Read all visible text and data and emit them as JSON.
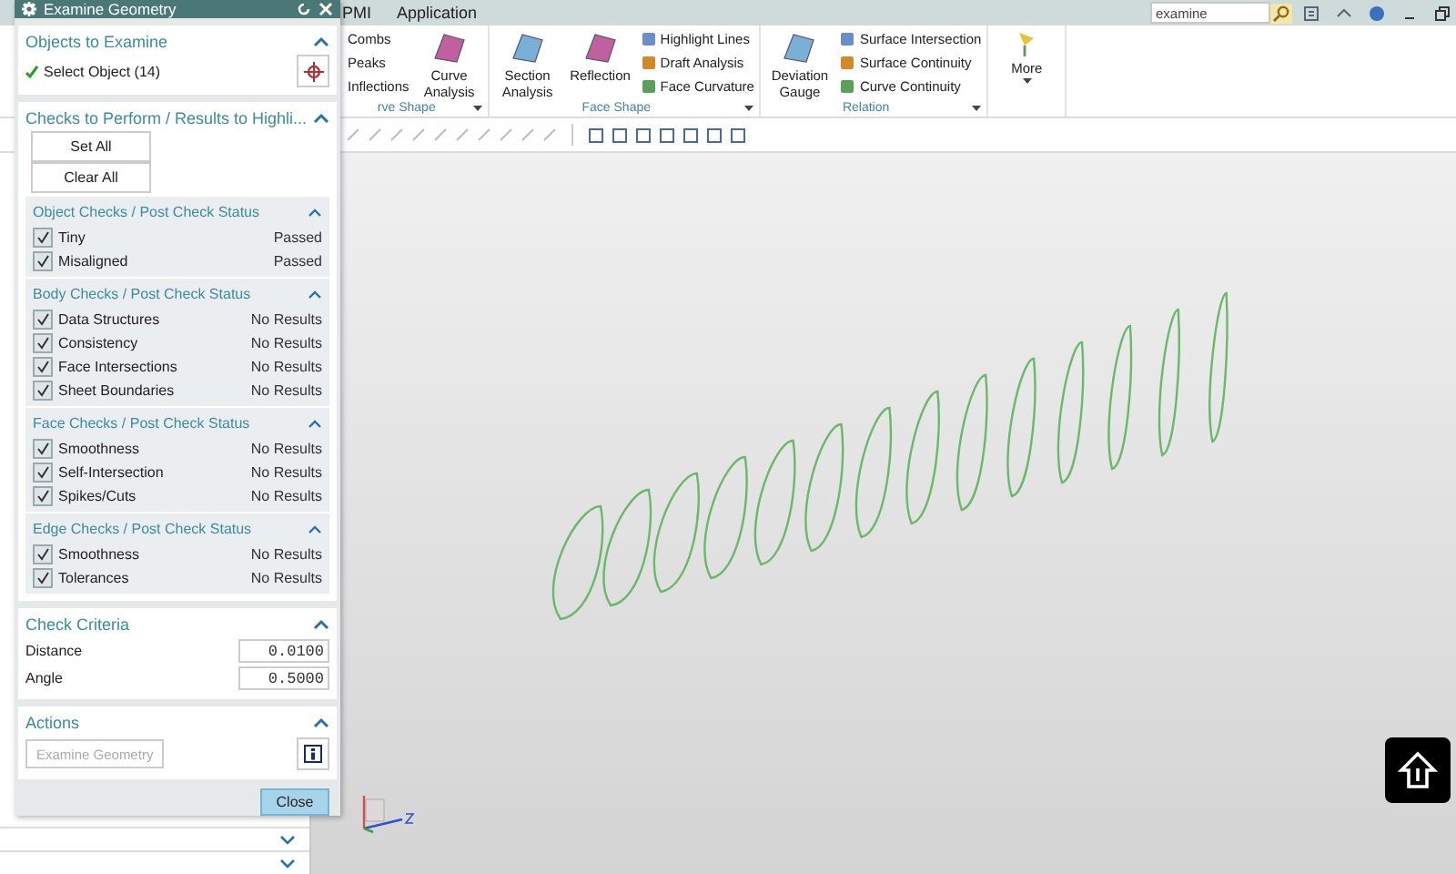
{
  "menu": [
    {
      "label": "PMI"
    },
    {
      "label": "Application"
    }
  ],
  "search": {
    "value": "examine"
  },
  "ribbon": [
    {
      "label": "rve Shape",
      "columns": [
        {
          "kind": "small",
          "items": [
            "Combs",
            "Peaks",
            "Inflections"
          ]
        },
        {
          "kind": "large",
          "label": "Curve Analysis"
        }
      ]
    },
    {
      "label": "Face Shape",
      "columns": [
        {
          "kind": "large",
          "label": "Section Analysis"
        },
        {
          "kind": "large",
          "label": "Reflection"
        },
        {
          "kind": "small",
          "items": [
            "Highlight Lines",
            "Draft Analysis",
            "Face Curvature"
          ]
        }
      ]
    },
    {
      "label": "Relation",
      "columns": [
        {
          "kind": "large",
          "label": "Deviation Gauge"
        },
        {
          "kind": "small",
          "items": [
            "Surface Intersection",
            "Surface Continuity",
            "Curve Continuity"
          ]
        }
      ]
    },
    {
      "columns": [
        {
          "kind": "more",
          "label": "More"
        }
      ]
    }
  ],
  "dialog": {
    "title": "Examine Geometry",
    "objects": {
      "title": "Objects to Examine",
      "expanded": true,
      "select_label": "Select Object (14)"
    },
    "checks": {
      "title": "Checks to Perform / Results to Highli...",
      "expanded": true,
      "set_all": "Set All",
      "clear_all": "Clear All",
      "groups": [
        {
          "title": "Object Checks / Post Check Status",
          "expanded": true,
          "items": [
            {
              "label": "Tiny",
              "checked": true,
              "status": "Passed"
            },
            {
              "label": "Misaligned",
              "checked": true,
              "status": "Passed"
            }
          ]
        },
        {
          "title": "Body Checks / Post Check Status",
          "expanded": true,
          "items": [
            {
              "label": "Data Structures",
              "checked": true,
              "status": "No Results"
            },
            {
              "label": "Consistency",
              "checked": true,
              "status": "No Results"
            },
            {
              "label": "Face Intersections",
              "checked": true,
              "status": "No Results"
            },
            {
              "label": "Sheet Boundaries",
              "checked": true,
              "status": "No Results"
            }
          ]
        },
        {
          "title": "Face Checks / Post Check Status",
          "expanded": true,
          "items": [
            {
              "label": "Smoothness",
              "checked": true,
              "status": "No Results"
            },
            {
              "label": "Self-Intersection",
              "checked": true,
              "status": "No Results"
            },
            {
              "label": "Spikes/Cuts",
              "checked": true,
              "status": "No Results"
            }
          ]
        },
        {
          "title": "Edge Checks / Post Check Status",
          "expanded": true,
          "items": [
            {
              "label": "Smoothness",
              "checked": true,
              "status": "No Results"
            },
            {
              "label": "Tolerances",
              "checked": true,
              "status": "No Results"
            }
          ]
        }
      ]
    },
    "criteria": {
      "title": "Check Criteria",
      "expanded": true,
      "fields": [
        {
          "label": "Distance",
          "value": "0.0100"
        },
        {
          "label": "Angle",
          "value": "0.5000"
        }
      ]
    },
    "actions": {
      "title": "Actions",
      "expanded": true,
      "button": "Examine Geometry",
      "disabled": true
    },
    "close": "Close"
  }
}
